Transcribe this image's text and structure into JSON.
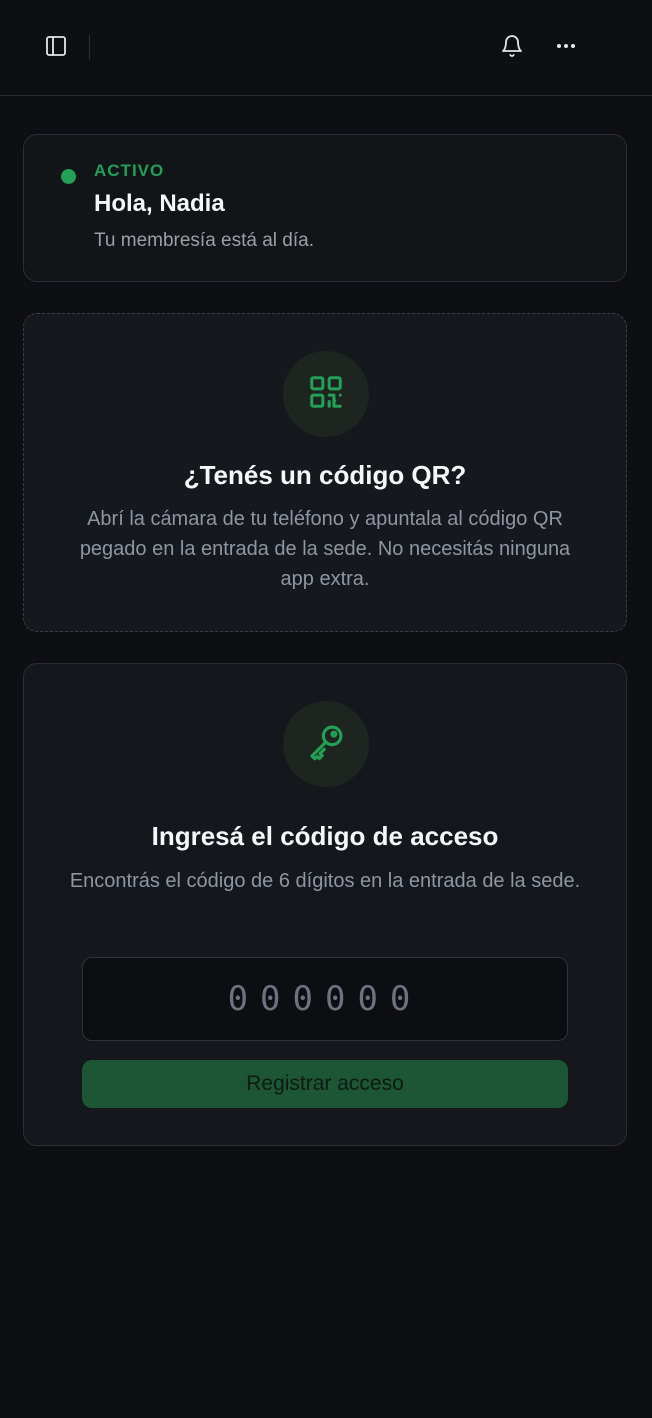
{
  "topbar": {
    "sidebar_icon": "sidebar-toggle-icon",
    "bell_icon": "bell-icon",
    "more_icon": "more-horizontal-icon"
  },
  "status": {
    "label": "ACTIVO",
    "greeting": "Hola, Nadia",
    "message": "Tu membresía está al día.",
    "color": "#22a055"
  },
  "qr": {
    "icon": "qr-code-icon",
    "title": "¿Tenés un código QR?",
    "description": "Abrí la cámara de tu teléfono y apuntala al código QR pegado en la entrada de la sede. No necesitás ninguna app extra."
  },
  "access": {
    "icon": "key-icon",
    "title": "Ingresá el código de acceso",
    "description": "Encontrás el código de 6 dígitos en la entrada de la sede.",
    "input_placeholder": "000000",
    "input_value": "",
    "submit_label": "Registrar acceso"
  }
}
